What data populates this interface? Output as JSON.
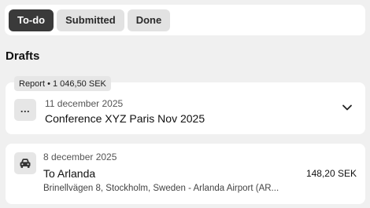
{
  "tabs": [
    {
      "label": "To-do",
      "active": true
    },
    {
      "label": "Submitted",
      "active": false
    },
    {
      "label": "Done",
      "active": false
    }
  ],
  "section": {
    "title": "Drafts"
  },
  "report_card": {
    "badge": "Report • 1 046,50 SEK",
    "icon": "more-dots-icon",
    "icon_text": "...",
    "date": "11 december 2025",
    "title": "Conference XYZ Paris Nov 2025",
    "chevron": "chevron-down-icon"
  },
  "expense_card": {
    "icon": "car-icon",
    "date": "8 december 2025",
    "title": "To Arlanda",
    "amount": "148,20 SEK",
    "route": "Brinellvägen 8, Stockholm, Sweden - Arlanda Airport (AR..."
  },
  "colors": {
    "background": "#f0f0f0",
    "active_tab": "#3a3a3a",
    "inactive_tab": "#e2e2e2",
    "card": "#ffffff"
  }
}
